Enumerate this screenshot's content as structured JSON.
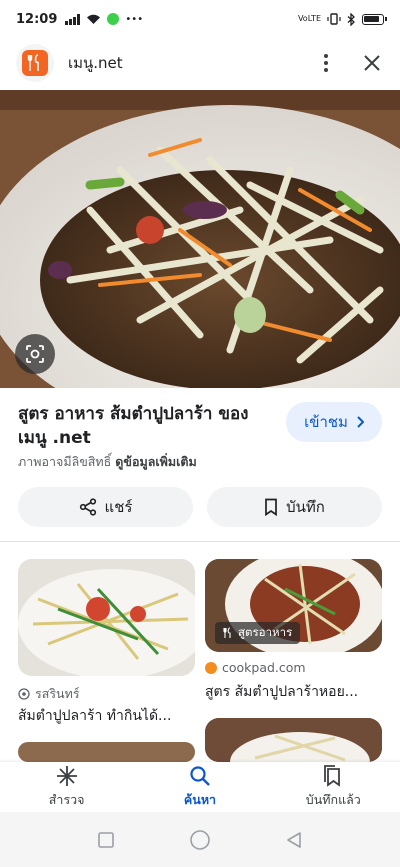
{
  "status_bar": {
    "time": "12:09",
    "right_label": "VoLTE"
  },
  "header": {
    "site_name": "เมนู.net",
    "logo_icon": "fork-spoon-icon"
  },
  "image": {
    "subject": "papaya salad"
  },
  "result": {
    "title": "สูตร อาหาร ส้มตำปูปลาร้า ของ เมนู .net",
    "visit_label": "เข้าชม",
    "copyright_text": "ภาพอาจมีลิขสิทธิ์",
    "learn_more": "ดูข้อมูลเพิ่มเติม"
  },
  "actions": {
    "share_label": "แชร์",
    "save_label": "บันทึก"
  },
  "related": [
    {
      "source": "รสรินทร์",
      "title": "ส้มตำปูปลาร้า ทำกินได้..."
    },
    {
      "chip": "สูตรอาหาร",
      "source": "cookpad.com",
      "title": "สูตร ส้มตำปูปลาร้าหอย..."
    }
  ],
  "bottom_nav": [
    {
      "label": "สำรวจ",
      "icon": "asterisk-icon"
    },
    {
      "label": "ค้นหา",
      "icon": "search-icon",
      "active": true
    },
    {
      "label": "บันทึกแล้ว",
      "icon": "bookmarks-icon"
    }
  ],
  "colors": {
    "accent": "#0b57d0",
    "logo": "#f26522"
  }
}
